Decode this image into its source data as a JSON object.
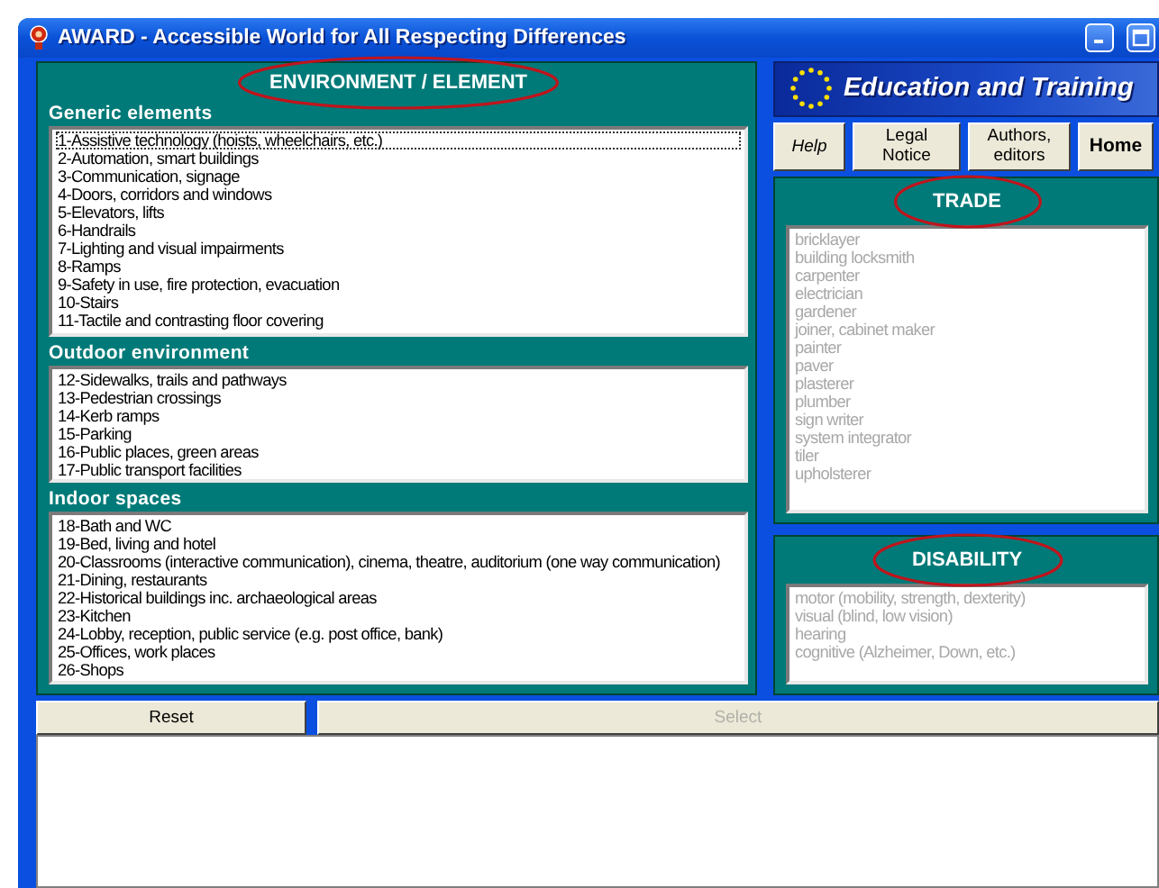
{
  "window": {
    "title": "AWARD - Accessible World for All Respecting Differences"
  },
  "environment": {
    "title": "ENVIRONMENT / ELEMENT",
    "circled": true,
    "groups": [
      {
        "heading": "Generic elements",
        "items": [
          {
            "label": "1-Assistive technology (hoists, wheelchairs, etc.)",
            "selected": true
          },
          {
            "label": "2-Automation, smart buildings",
            "selected": false
          },
          {
            "label": "3-Communication, signage",
            "selected": false
          },
          {
            "label": "4-Doors, corridors and windows",
            "selected": false
          },
          {
            "label": "5-Elevators, lifts",
            "selected": false
          },
          {
            "label": "6-Handrails",
            "selected": false
          },
          {
            "label": "7-Lighting and visual impairments",
            "selected": false
          },
          {
            "label": "8-Ramps",
            "selected": false
          },
          {
            "label": "9-Safety in use, fire protection, evacuation",
            "selected": false
          },
          {
            "label": "10-Stairs",
            "selected": false
          },
          {
            "label": "11-Tactile and contrasting floor covering",
            "selected": false
          }
        ]
      },
      {
        "heading": "Outdoor environment",
        "items": [
          {
            "label": "12-Sidewalks, trails and pathways",
            "selected": false
          },
          {
            "label": "13-Pedestrian crossings",
            "selected": false
          },
          {
            "label": "14-Kerb ramps",
            "selected": false
          },
          {
            "label": "15-Parking",
            "selected": false
          },
          {
            "label": "16-Public places, green areas",
            "selected": false
          },
          {
            "label": "17-Public transport facilities",
            "selected": false
          }
        ]
      },
      {
        "heading": "Indoor spaces",
        "items": [
          {
            "label": "18-Bath and WC",
            "selected": false
          },
          {
            "label": "19-Bed, living and hotel",
            "selected": false
          },
          {
            "label": "20-Classrooms (interactive communication), cinema, theatre, auditorium (one way communication)",
            "selected": false
          },
          {
            "label": "21-Dining, restaurants",
            "selected": false
          },
          {
            "label": "22-Historical buildings inc. archaeological areas",
            "selected": false
          },
          {
            "label": "23-Kitchen",
            "selected": false
          },
          {
            "label": "24-Lobby, reception, public service (e.g. post office, bank)",
            "selected": false
          },
          {
            "label": "25-Offices, work places",
            "selected": false
          },
          {
            "label": "26-Shops",
            "selected": false
          }
        ]
      }
    ]
  },
  "banner": {
    "text": "Education and Training"
  },
  "nav_buttons": [
    {
      "label": "Help",
      "kind": "italic"
    },
    {
      "label": "Legal Notice",
      "kind": "plain"
    },
    {
      "label": "Authors, editors",
      "kind": "plain"
    },
    {
      "label": "Home",
      "kind": "bold"
    }
  ],
  "trade": {
    "title": "TRADE",
    "circled": true,
    "items": [
      {
        "label": "bricklayer",
        "disabled": true
      },
      {
        "label": "building locksmith",
        "disabled": true
      },
      {
        "label": "carpenter",
        "disabled": true
      },
      {
        "label": "electrician",
        "disabled": true
      },
      {
        "label": "gardener",
        "disabled": true
      },
      {
        "label": "joiner, cabinet maker",
        "disabled": true
      },
      {
        "label": "painter",
        "disabled": true
      },
      {
        "label": "paver",
        "disabled": true
      },
      {
        "label": "plasterer",
        "disabled": true
      },
      {
        "label": "plumber",
        "disabled": true
      },
      {
        "label": "sign writer",
        "disabled": true
      },
      {
        "label": "system integrator",
        "disabled": true
      },
      {
        "label": "tiler",
        "disabled": true
      },
      {
        "label": "upholsterer",
        "disabled": true
      }
    ]
  },
  "disability": {
    "title": "DISABILITY",
    "circled": true,
    "items": [
      {
        "label": "motor (mobility, strength, dexterity)",
        "disabled": true
      },
      {
        "label": "visual (blind, low vision)",
        "disabled": true
      },
      {
        "label": "hearing",
        "disabled": true
      },
      {
        "label": "cognitive (Alzheimer, Down, etc.)",
        "disabled": true
      }
    ]
  },
  "actions": [
    {
      "label": "Reset",
      "disabled": false
    },
    {
      "label": "Select",
      "disabled": true
    }
  ]
}
